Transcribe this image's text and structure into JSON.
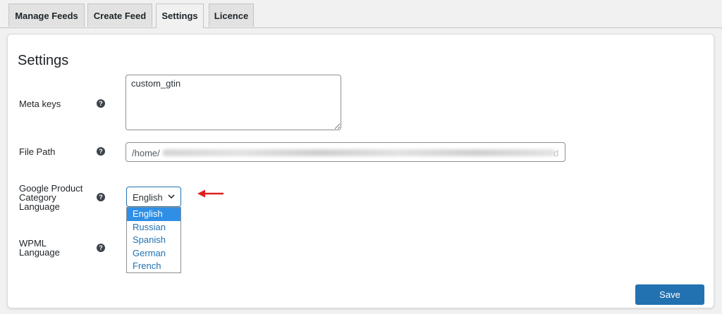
{
  "tabs": [
    {
      "label": "Manage Feeds",
      "active": false
    },
    {
      "label": "Create Feed",
      "active": false
    },
    {
      "label": "Settings",
      "active": true
    },
    {
      "label": "Licence",
      "active": false
    }
  ],
  "page": {
    "title": "Settings"
  },
  "fields": {
    "meta_keys": {
      "label": "Meta keys",
      "value": "custom_gtin"
    },
    "file_path": {
      "label": "File Path",
      "value_prefix": "/home/",
      "value_suffix": "d"
    },
    "google_lang": {
      "label_line1": "Google Product",
      "label_line2": "Category",
      "label_line3": "Language",
      "selected": "English",
      "options": [
        "English",
        "Russian",
        "Spanish",
        "German",
        "French"
      ]
    },
    "wpml": {
      "label_line1": "WPML",
      "label_line2": "Language"
    }
  },
  "help_glyph": "?",
  "save_label": "Save",
  "colors": {
    "accent": "#2271b1",
    "highlight": "#2f8fe6",
    "annotation_arrow": "#e02020"
  }
}
